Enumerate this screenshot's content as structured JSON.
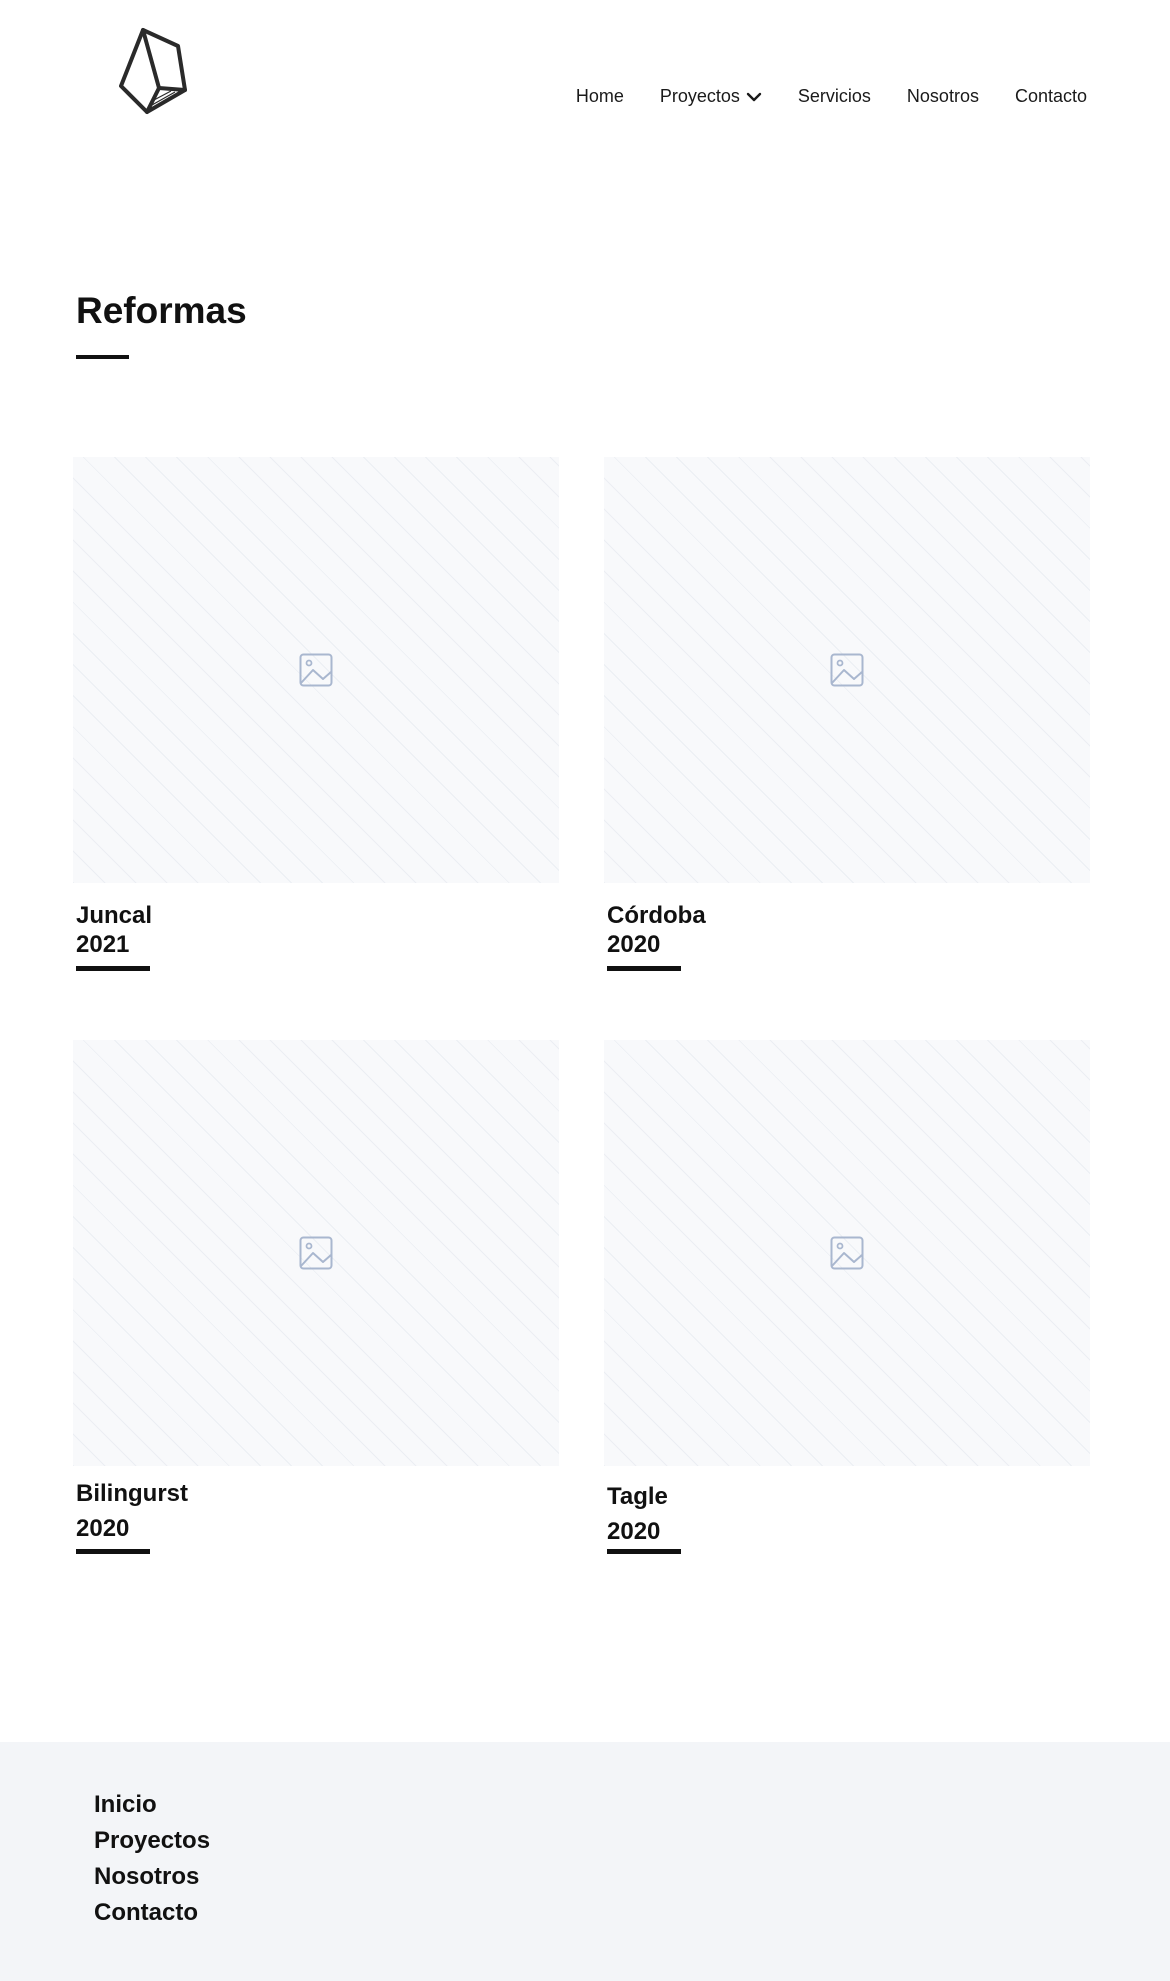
{
  "header": {
    "logo_icon": "polyhedron-logo-icon",
    "nav": [
      {
        "label": "Home"
      },
      {
        "label": "Proyectos",
        "has_dropdown": true
      },
      {
        "label": "Servicios"
      },
      {
        "label": "Nosotros"
      },
      {
        "label": "Contacto"
      }
    ]
  },
  "main": {
    "title": "Reformas",
    "projects": [
      {
        "name": "Juncal",
        "year": "2021",
        "image_icon": "image-placeholder-icon"
      },
      {
        "name": "Córdoba",
        "year": "2020",
        "image_icon": "image-placeholder-icon"
      },
      {
        "name": "Bilingurst",
        "year": "2020",
        "image_icon": "image-placeholder-icon"
      },
      {
        "name": "Tagle",
        "year": "2020",
        "image_icon": "image-placeholder-icon"
      }
    ]
  },
  "footer": {
    "links": [
      "Inicio",
      "Proyectos",
      "Nosotros",
      "Contacto"
    ]
  },
  "colors": {
    "text": "#111111",
    "placeholder_bg": "#f8f9fb",
    "placeholder_icon": "#a9b7cf",
    "footer_bg": "#f3f5f8"
  }
}
